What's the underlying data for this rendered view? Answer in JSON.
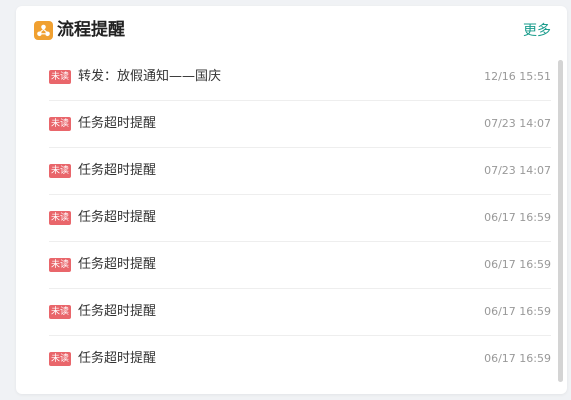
{
  "widget": {
    "title": "流程提醒",
    "more_label": "更多",
    "icon": "process-icon",
    "accent_color": "#1a9c8c",
    "icon_color": "#f0a030"
  },
  "reminders": [
    {
      "badge": "未读",
      "title": "转发：放假通知——国庆",
      "time": "12/16 15:51"
    },
    {
      "badge": "未读",
      "title": "任务超时提醒",
      "time": "07/23 14:07"
    },
    {
      "badge": "未读",
      "title": "任务超时提醒",
      "time": "07/23 14:07"
    },
    {
      "badge": "未读",
      "title": "任务超时提醒",
      "time": "06/17 16:59"
    },
    {
      "badge": "未读",
      "title": "任务超时提醒",
      "time": "06/17 16:59"
    },
    {
      "badge": "未读",
      "title": "任务超时提醒",
      "time": "06/17 16:59"
    },
    {
      "badge": "未读",
      "title": "任务超时提醒",
      "time": "06/17 16:59"
    }
  ],
  "colors": {
    "badge_bg": "#e9666b"
  }
}
